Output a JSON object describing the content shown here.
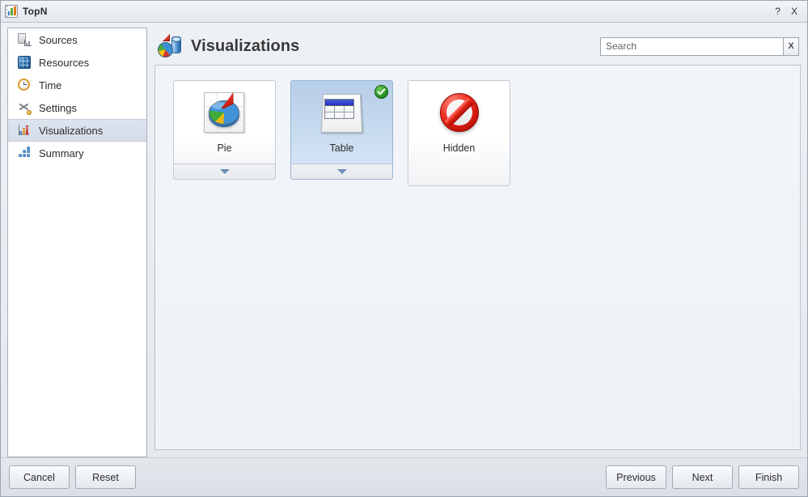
{
  "window": {
    "title": "TopN",
    "icon": "bar-chart-icon",
    "help_label": "?",
    "close_label": "X"
  },
  "sidebar": {
    "items": [
      {
        "label": "Sources",
        "icon": "sources-icon",
        "selected": false
      },
      {
        "label": "Resources",
        "icon": "resources-cube-icon",
        "selected": false
      },
      {
        "label": "Time",
        "icon": "clock-icon",
        "selected": false
      },
      {
        "label": "Settings",
        "icon": "scissors-tool-icon",
        "selected": false
      },
      {
        "label": "Visualizations",
        "icon": "bar-chart-icon",
        "selected": true
      },
      {
        "label": "Summary",
        "icon": "blocks-grid-icon",
        "selected": false
      }
    ]
  },
  "header": {
    "title": "Visualizations",
    "icon": "pie-cylinder-3d-icon"
  },
  "search": {
    "value": "",
    "placeholder": "Search",
    "clear_label": "X",
    "clear_icon": "close-icon"
  },
  "visualizations": {
    "cards": [
      {
        "label": "Pie",
        "icon": "pie-chart-3d-icon",
        "selected": false,
        "has_expander": true,
        "expander_icon": "chevron-down-icon"
      },
      {
        "label": "Table",
        "icon": "table-grid-icon",
        "selected": true,
        "has_expander": true,
        "expander_icon": "chevron-down-icon",
        "badge_icon": "check-circle-icon"
      },
      {
        "label": "Hidden",
        "icon": "prohibition-sign-icon",
        "selected": false,
        "has_expander": false
      }
    ]
  },
  "footer": {
    "cancel_label": "Cancel",
    "reset_label": "Reset",
    "previous_label": "Previous",
    "next_label": "Next",
    "finish_label": "Finish"
  },
  "colors": {
    "selection_blue": "#c9dcf0",
    "sidebar_selection": "#dde4ee",
    "badge_green": "#2e9b2a",
    "hidden_red": "#e22718",
    "table_header_blue": "#2433c2"
  }
}
